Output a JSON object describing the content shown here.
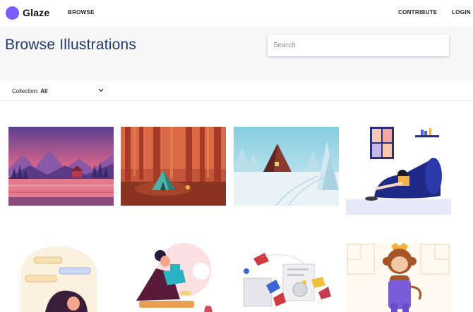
{
  "brand": {
    "name": "Glaze",
    "accent": "#7a5cff"
  },
  "nav": {
    "browse_label": "BROWSE",
    "contribute_label": "CONTRIBUTE",
    "login_label": "LOGIN"
  },
  "header": {
    "title": "Browse Illustrations",
    "search_placeholder": "Search"
  },
  "filter": {
    "label": "Collection:",
    "value": "All"
  },
  "illustrations": [
    {
      "subject": "sunset-lake-cabin"
    },
    {
      "subject": "forest-campsite-tent"
    },
    {
      "subject": "snowy-cabin-road"
    },
    {
      "subject": "woman-reading-armchair"
    },
    {
      "subject": "woman-with-chat-bubbles"
    },
    {
      "subject": "woman-working-laptop"
    },
    {
      "subject": "team-flying-gears"
    },
    {
      "subject": "monkey-mascot"
    }
  ]
}
